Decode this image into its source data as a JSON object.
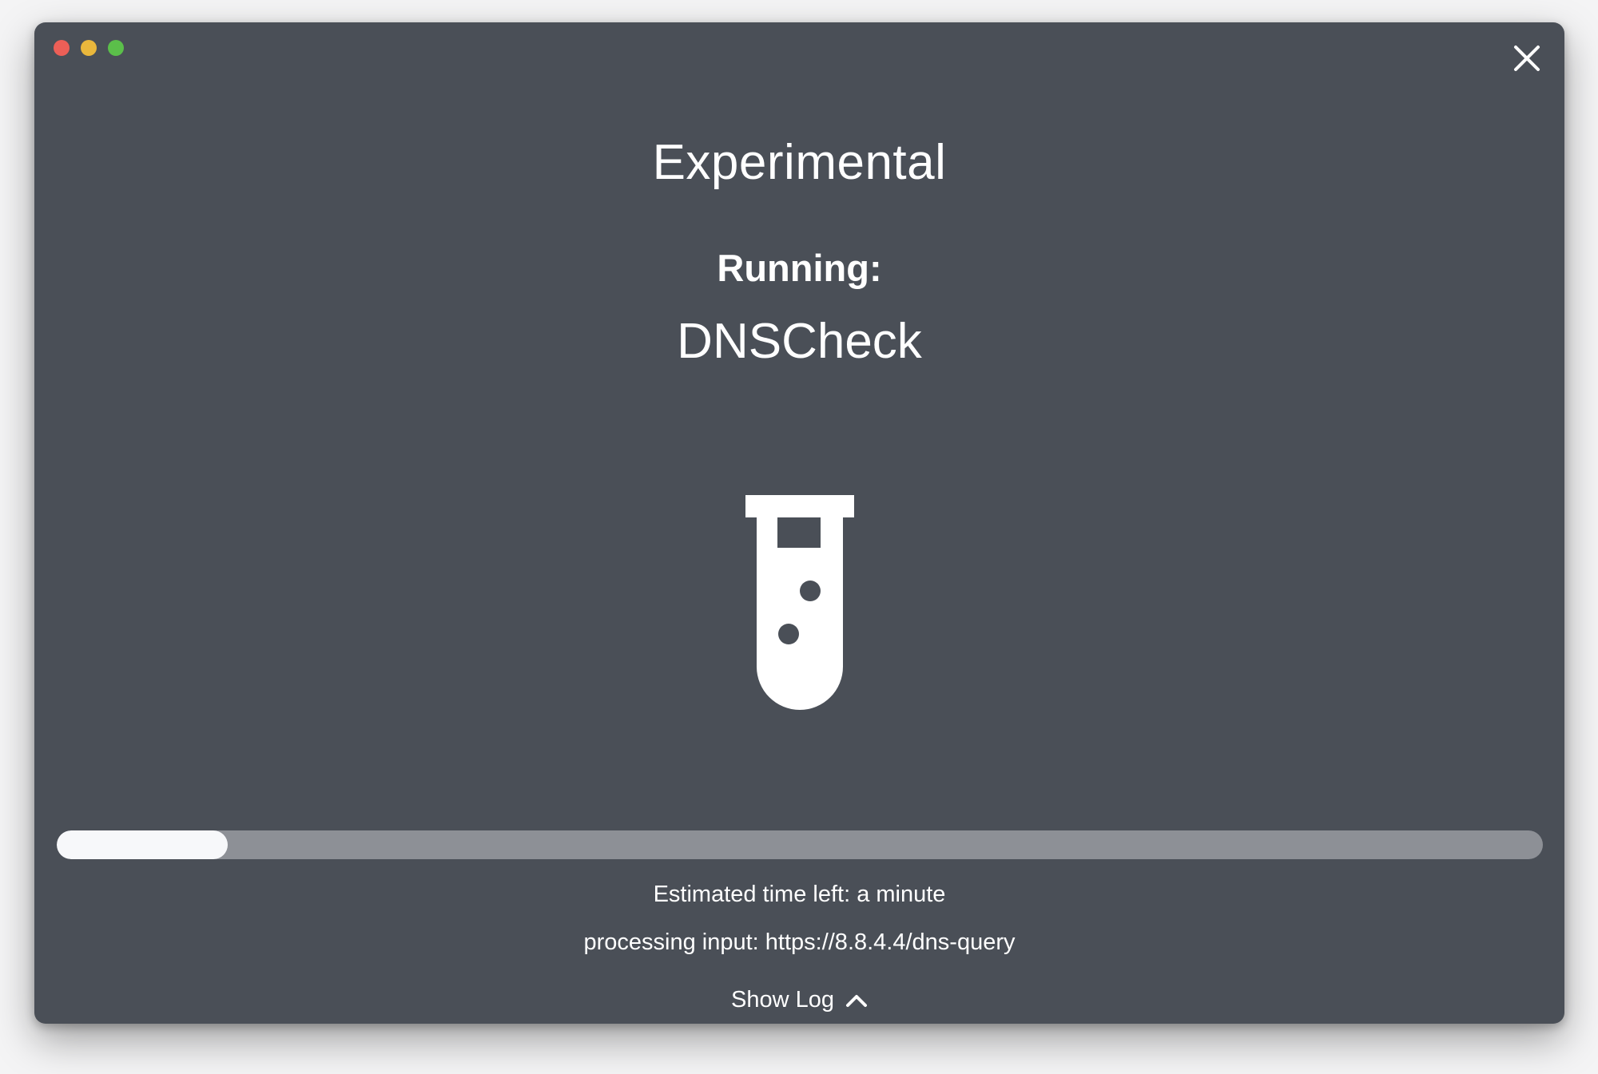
{
  "window": {
    "traffic_lights": [
      {
        "name": "close",
        "color": "#ec5f57"
      },
      {
        "name": "minimize",
        "color": "#e9b73c"
      },
      {
        "name": "zoom",
        "color": "#5bbf4a"
      }
    ],
    "close_icon": "close-x-icon",
    "background": "#4a4f57"
  },
  "header": {
    "title": "Experimental",
    "running_label": "Running:",
    "test_name": "DNSCheck"
  },
  "illustration": {
    "icon": "test-tube-icon"
  },
  "progress": {
    "fraction": 0.115,
    "track_color": "#8d9096",
    "fill_color": "#f7f8fa"
  },
  "status": {
    "eta": "Estimated time left: a minute",
    "processing": "processing input: https://8.8.4.4/dns-query"
  },
  "footer": {
    "show_log_label": "Show Log",
    "show_log_icon": "chevron-up-icon"
  }
}
